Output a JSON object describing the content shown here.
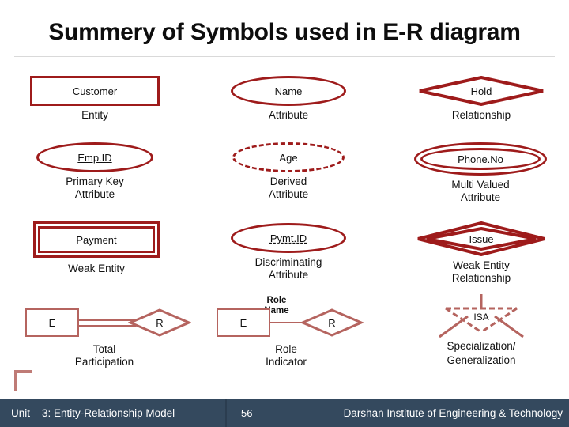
{
  "slide": {
    "title": "Summery of Symbols used in E-R diagram"
  },
  "symbols": [
    {
      "shape": "rectangle",
      "text": "Customer",
      "caption_line1": "Entity",
      "caption_line2": ""
    },
    {
      "shape": "ellipse",
      "text": "Name",
      "caption_line1": "Attribute",
      "caption_line2": ""
    },
    {
      "shape": "diamond",
      "text": "Hold",
      "caption_line1": "Relationship",
      "caption_line2": ""
    },
    {
      "shape": "ellipse-underlined",
      "text": "Emp.ID",
      "caption_line1": "Primary Key",
      "caption_line2": "Attribute"
    },
    {
      "shape": "ellipse-dashed",
      "text": "Age",
      "caption_line1": "Derived",
      "caption_line2": "Attribute"
    },
    {
      "shape": "double-ellipse",
      "text": "Phone.No",
      "caption_line1": "Multi Valued",
      "caption_line2": "Attribute"
    },
    {
      "shape": "double-rectangle",
      "text": "Payment",
      "caption_line1": "Weak Entity",
      "caption_line2": ""
    },
    {
      "shape": "ellipse-dashed-underlined",
      "text": "Pymt.ID",
      "caption_line1": "Discriminating",
      "caption_line2": "Attribute"
    },
    {
      "shape": "double-diamond",
      "text": "Issue",
      "caption_line1": "Weak Entity",
      "caption_line2": "Relationship"
    }
  ],
  "bottom_row": {
    "total_participation": {
      "entity_text": "E",
      "relationship_text": "R",
      "caption_line1": "Total",
      "caption_line2": "Participation"
    },
    "role_indicator": {
      "entity_text": "E",
      "relationship_text": "R",
      "role_label_line1": "Role",
      "role_label_line2": "Name",
      "caption_line1": "Role",
      "caption_line2": "Indicator"
    },
    "isa": {
      "text": "ISA",
      "caption_line1": "Specialization/",
      "caption_line2": "Generalization"
    }
  },
  "footer": {
    "unit": "Unit – 3: Entity-Relationship Model",
    "page": "56",
    "organization": "Darshan Institute of Engineering & Technology"
  },
  "colors": {
    "symbol_red": "#9e1b1b",
    "light_red": "#b5645f",
    "footer_bg": "#34495e",
    "title_text": "#0d0d0d",
    "rule": "#d9d9d9"
  }
}
